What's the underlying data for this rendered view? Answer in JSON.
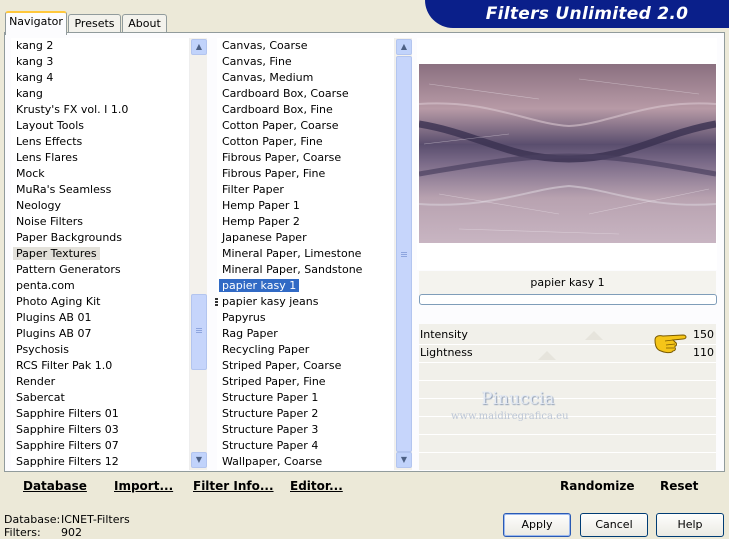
{
  "header": {
    "title": "Filters Unlimited 2.0"
  },
  "tabs": [
    {
      "label": "Navigator"
    },
    {
      "label": "Presets"
    },
    {
      "label": "About"
    }
  ],
  "categories": {
    "items": [
      "kang 2",
      "kang 3",
      "kang 4",
      "kang",
      "Krusty's FX vol. I 1.0",
      "Layout Tools",
      "Lens Effects",
      "Lens Flares",
      "Mock",
      "MuRa's Seamless",
      "Neology",
      "Noise Filters",
      "Paper Backgrounds",
      "Paper Textures",
      "Pattern Generators",
      "penta.com",
      "Photo Aging Kit",
      "Plugins AB 01",
      "Plugins AB 07",
      "Psychosis",
      "RCS Filter Pak 1.0",
      "Render",
      "Sabercat",
      "Sapphire Filters 01",
      "Sapphire Filters 03",
      "Sapphire Filters 07",
      "Sapphire Filters 12"
    ],
    "selected": "Paper Textures"
  },
  "filters": {
    "items": [
      "Canvas, Coarse",
      "Canvas, Fine",
      "Canvas, Medium",
      "Cardboard Box, Coarse",
      "Cardboard Box, Fine",
      "Cotton Paper, Coarse",
      "Cotton Paper, Fine",
      "Fibrous Paper, Coarse",
      "Fibrous Paper, Fine",
      "Filter Paper",
      "Hemp Paper 1",
      "Hemp Paper 2",
      "Japanese Paper",
      "Mineral Paper, Limestone",
      "Mineral Paper, Sandstone",
      "papier kasy 1",
      "papier kasy jeans",
      "Papyrus",
      "Rag Paper",
      "Recycling Paper",
      "Striped Paper, Coarse",
      "Striped Paper, Fine",
      "Structure Paper 1",
      "Structure Paper 2",
      "Structure Paper 3",
      "Structure Paper 4",
      "Wallpaper, Coarse"
    ],
    "selected": "papier kasy 1"
  },
  "preview": {
    "filter_name": "papier kasy 1",
    "watermark_name": "Pinuccia",
    "watermark_url": "www.maidiregrafica.eu"
  },
  "params": [
    {
      "name": "Intensity",
      "value": "150",
      "level": 0.59
    },
    {
      "name": "Lightness",
      "value": "110",
      "level": 0.43
    }
  ],
  "bottom_buttons": {
    "database": "Database",
    "import": "Import...",
    "filter_info": "Filter Info...",
    "editor": "Editor...",
    "randomize": "Randomize",
    "reset": "Reset"
  },
  "status": {
    "database_label": "Database:",
    "database_value": "ICNET-Filters",
    "filters_label": "Filters:",
    "filters_value": "902"
  },
  "dialog_buttons": {
    "apply": "Apply",
    "cancel": "Cancel",
    "help": "Help"
  },
  "colors": {
    "header": "#0a1f8a",
    "selection": "#316ac5",
    "scroll_button": "#c1d3fb"
  }
}
